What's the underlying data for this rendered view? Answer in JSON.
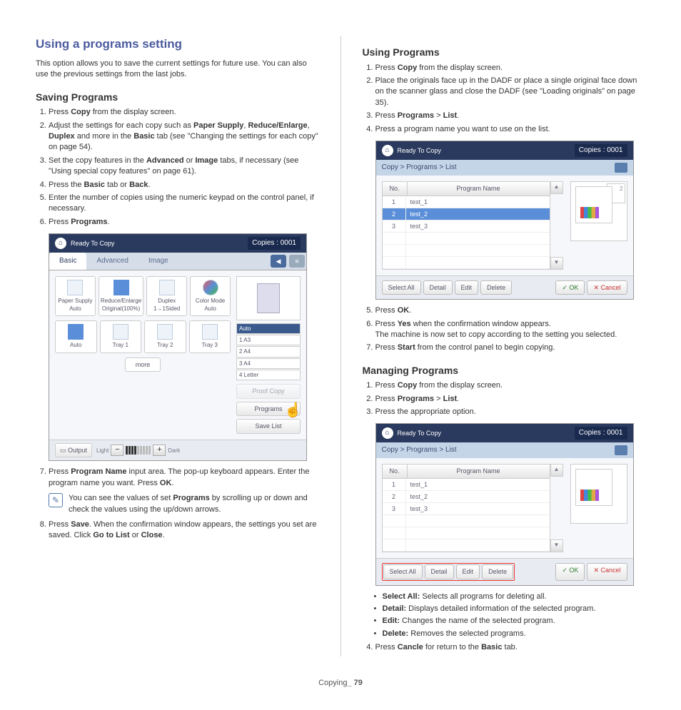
{
  "h1": "Using a programs setting",
  "intro": "This option allows you to save the current settings for future use. You can also use the previous settings from the last jobs.",
  "saving": {
    "title": "Saving Programs",
    "s1a": "Press ",
    "s1b": "Copy",
    "s1c": " from the display screen.",
    "s2a": "Adjust the settings for each copy such as ",
    "s2b": "Paper Supply",
    "s2c": ", ",
    "s2d": "Reduce/Enlarge",
    "s2e": ", ",
    "s2f": "Duplex",
    "s2g": " and more in the ",
    "s2h": "Basic",
    "s2i": " tab (see \"Changing the settings for each copy\" on page 54).",
    "s3a": "Set the copy features in the ",
    "s3b": "Advanced",
    "s3c": " or ",
    "s3d": "Image",
    "s3e": " tabs, if necessary (see \"Using special copy features\" on page 61).",
    "s4a": "Press the ",
    "s4b": "Basic",
    "s4c": " tab or ",
    "s4d": "Back",
    "s4e": ".",
    "s5": "Enter the number of copies using the numeric keypad on the control panel, if necessary.",
    "s6a": "Press ",
    "s6b": "Programs",
    "s6c": ".",
    "s7a": "Press ",
    "s7b": "Program Name",
    "s7c": " input area. The pop-up keyboard appears. Enter the program name you want. Press ",
    "s7d": "OK",
    "s7e": ".",
    "notea": "You can see the values of set ",
    "noteb": "Programs",
    "notec": " by scrolling up or down and check the values using the up/down arrows.",
    "s8a": "Press ",
    "s8b": "Save",
    "s8c": ". When the confirmation window appears, the settings you set are saved. Click ",
    "s8d": "Go to List",
    "s8e": " or ",
    "s8f": "Close",
    "s8g": "."
  },
  "using": {
    "title": "Using Programs",
    "s1a": "Press ",
    "s1b": "Copy",
    "s1c": " from the display screen.",
    "s2": "Place the originals face up in the DADF or place a single original face down on the scanner glass and close the DADF (see \"Loading originals\" on page 35).",
    "s3a": "Press ",
    "s3b": "Programs",
    "s3c": " > ",
    "s3d": "List",
    "s3e": ".",
    "s4": "Press a program name you want to use on the list.",
    "s5a": "Press ",
    "s5b": "OK",
    "s5c": ".",
    "s6a": "Press ",
    "s6b": "Yes",
    "s6c": " when the confirmation window appears.",
    "s6d": "The machine is now set to copy according to the setting you selected.",
    "s7a": "Press ",
    "s7b": "Start",
    "s7c": " from the control panel to begin copying."
  },
  "managing": {
    "title": "Managing Programs",
    "s1a": "Press ",
    "s1b": "Copy",
    "s1c": " from the display screen.",
    "s2a": "Press ",
    "s2b": "Programs",
    "s2c": " > ",
    "s2d": "List",
    "s2e": ".",
    "s3": "Press the appropriate option.",
    "b1a": "Select All:",
    "b1b": "  Selects all programs for deleting all.",
    "b2a": "Detail:",
    "b2b": "  Displays detailed information of the selected program.",
    "b3a": "Edit:",
    "b3b": "  Changes the name of the selected program.",
    "b4a": "Delete:",
    "b4b": "  Removes the selected programs.",
    "s4a": "Press ",
    "s4b": "Cancle",
    "s4c": " for return to the ",
    "s4d": "Basic",
    "s4e": " tab."
  },
  "shot": {
    "ready": "Ready To Copy",
    "copies": "Copies : 0001",
    "basic": "Basic",
    "advanced": "Advanced",
    "image": "Image",
    "paper": "Paper Supply",
    "paperv": "Auto",
    "reduce": "Reduce/Enlarge",
    "reducev": "Original(100%)",
    "duplex": "Duplex",
    "duplexv": "1→1Sided",
    "color": "Color Mode",
    "colorv": "Auto",
    "auto": "Auto",
    "t1": "Tray 1",
    "t2": "Tray 2",
    "t3": "Tray 3",
    "more": "more",
    "trauto": "Auto",
    "tra3": "A3",
    "tra4": "A4",
    "trlt": "Letter",
    "output": "Output",
    "light": "Light",
    "dark": "Dark",
    "proof": "Proof Copy",
    "programs": "Programs",
    "savelist": "Save List",
    "crumb": "Copy > Programs > List",
    "no": "No.",
    "pname": "Program Name",
    "r1": "test_1",
    "r2": "test_2",
    "r3": "test_3",
    "selall": "Select All",
    "detail": "Detail",
    "edit": "Edit",
    "delete": "Delete",
    "ok": "OK",
    "cancel": "Cancel"
  },
  "footer": {
    "a": "Copying",
    "b": "_ 79"
  }
}
